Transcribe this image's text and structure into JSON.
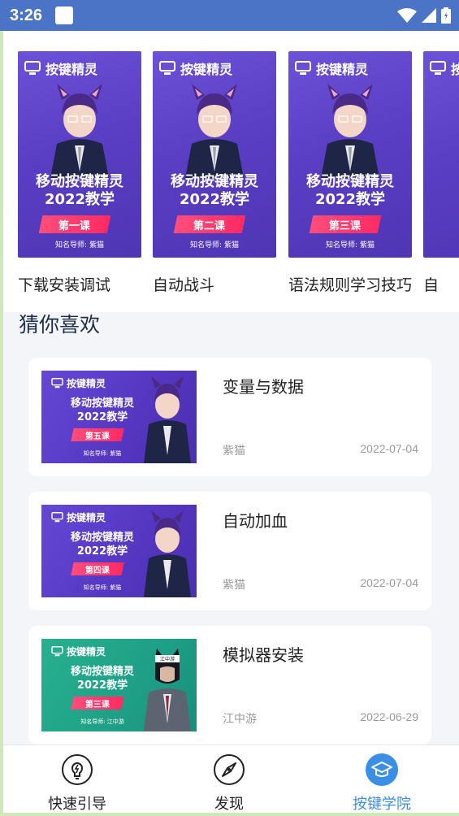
{
  "status_bar": {
    "time": "3:26"
  },
  "courses": [
    {
      "caption": "下载安装调试",
      "brand": "按键精灵",
      "title_line1": "移动按键精灵",
      "title_line2": "2022教学",
      "lesson": "第一课",
      "teacher": "知名导师: 紫猫"
    },
    {
      "caption": "自动战斗",
      "brand": "按键精灵",
      "title_line1": "移动按键精灵",
      "title_line2": "2022教学",
      "lesson": "第二课",
      "teacher": "知名导师: 紫猫"
    },
    {
      "caption": "语法规则学习技巧",
      "brand": "按键精灵",
      "title_line1": "移动按键精灵",
      "title_line2": "2022教学",
      "lesson": "第三课",
      "teacher": "知名导师: 紫猫"
    },
    {
      "caption": "自",
      "brand": "按",
      "title_line1": "",
      "title_line2": "",
      "lesson": "",
      "teacher": ""
    }
  ],
  "recommend": {
    "title": "猜你喜欢",
    "items": [
      {
        "title": "变量与数据",
        "author": "紫猫",
        "date": "2022-07-04",
        "brand": "按键精灵",
        "title_line1": "移动按键精灵",
        "title_line2": "2022教学",
        "lesson": "第五课",
        "teacher": "知名导师: 紫猫",
        "theme": "purple"
      },
      {
        "title": "自动加血",
        "author": "紫猫",
        "date": "2022-07-04",
        "brand": "按键精灵",
        "title_line1": "移动按键精灵",
        "title_line2": "2022教学",
        "lesson": "第四课",
        "teacher": "知名导师: 紫猫",
        "theme": "purple"
      },
      {
        "title": "模拟器安装",
        "author": "江中游",
        "date": "2022-06-29",
        "brand": "按键精灵",
        "title_line1": "移动按键精灵",
        "title_line2": "2022教学",
        "lesson": "第三课",
        "teacher": "知名导师: 江中游",
        "badge": "江中游",
        "theme": "teal"
      }
    ]
  },
  "nav": [
    {
      "label": "快速引导",
      "icon": "lightbulb-icon",
      "active": false
    },
    {
      "label": "发现",
      "icon": "compass-icon",
      "active": false
    },
    {
      "label": "按键学院",
      "icon": "graduation-cap-icon",
      "active": true
    }
  ],
  "colors": {
    "status_bar": "#4b73c6",
    "accent": "#3a8ee6",
    "ribbon": "#ff2b63",
    "thumb_purple": "#5a3ec4",
    "thumb_teal": "#1f9f86"
  }
}
